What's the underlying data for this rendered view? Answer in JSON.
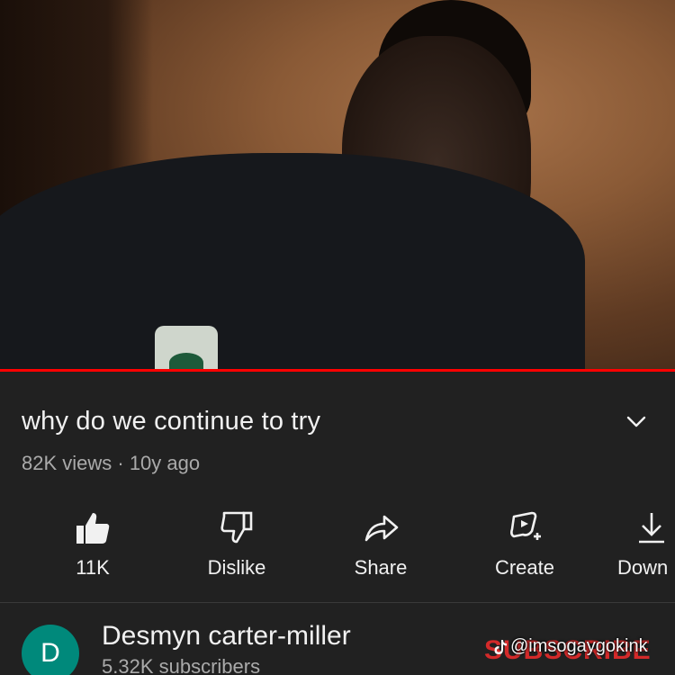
{
  "video": {
    "progress_fraction": 1.0,
    "accent_color": "#ff0000"
  },
  "details": {
    "title": "why do we continue to try",
    "meta": "82K views · 10y ago",
    "expand_icon": "chevron-down-icon"
  },
  "actions": [
    {
      "label": "11K",
      "icon": "thumbs-up-icon"
    },
    {
      "label": "Dislike",
      "icon": "thumbs-down-icon"
    },
    {
      "label": "Share",
      "icon": "share-icon"
    },
    {
      "label": "Create",
      "icon": "create-icon"
    },
    {
      "label": "Down",
      "icon": "download-icon"
    }
  ],
  "channel": {
    "avatar_letter": "D",
    "avatar_color": "#00897b",
    "name": "Desmyn carter-miller",
    "subscribers": "5.32K subscribers",
    "subscribe_label": "SUBSCRIBE"
  },
  "overlay": {
    "watermark": "@imsogaygokink",
    "watermark_icon": "tiktok-icon"
  }
}
